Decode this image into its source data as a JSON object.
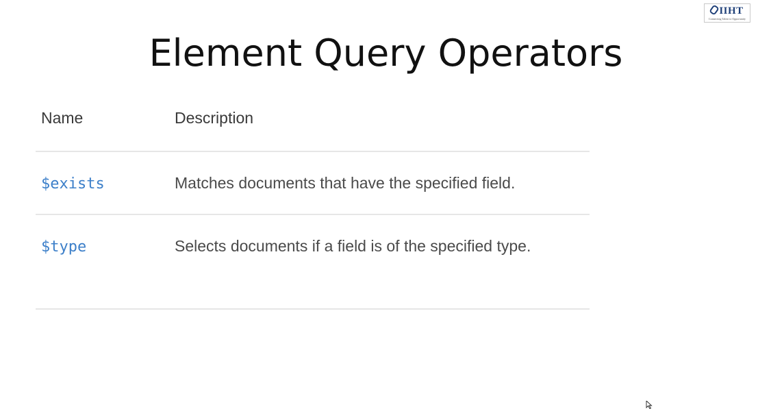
{
  "logo": {
    "brand": "IIHT",
    "tagline": "Connecting Talent to Opportunity"
  },
  "slide": {
    "title": "Element Query Operators"
  },
  "table": {
    "headers": {
      "name": "Name",
      "description": "Description"
    },
    "rows": [
      {
        "name": "$exists",
        "description": "Matches documents that have the specified field."
      },
      {
        "name": "$type",
        "description": "Selects documents if a field is of the specified type."
      }
    ]
  },
  "colors": {
    "operator": "#3c7fc9",
    "text": "#4a4a4a",
    "divider": "#e6e6e6",
    "title": "#111111"
  }
}
